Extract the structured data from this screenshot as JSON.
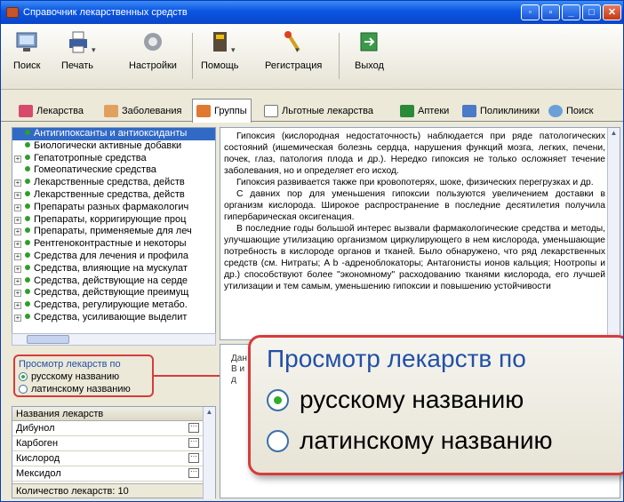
{
  "window": {
    "title": "Справочник лекарственных средств"
  },
  "toolbar": {
    "search": "Поиск",
    "print": "Печать",
    "settings": "Настройки",
    "help": "Помощь",
    "registration": "Регистрация",
    "exit": "Выход"
  },
  "tabs": [
    "Лекарства",
    "Заболевания",
    "Группы",
    "Льготные лекарства",
    "Аптеки",
    "Поликлиники",
    "Поиск"
  ],
  "tree": [
    "Антигипоксанты и антиоксиданты",
    "Биологически активные добавки",
    "Гепатотропные средства",
    "Гомеопатические средства",
    "Лекарственные средства, действ",
    "Лекарственные средства, действ",
    "Препараты разных фармакологич",
    "Препараты, корригирующие проц",
    "Препараты, применяемые для леч",
    "Рентгеноконтрастные и некоторы",
    "Средства для лечения и профила",
    "Средства, влияющие на мускулат",
    "Средства, действующие на серде",
    "Средства, действующие преимущ",
    "Средства, регулирующие метабо.",
    "Средства, усиливающие выделит"
  ],
  "article": [
    "Гипоксия (кислородная недостаточность) наблюдается при ряде патологических состояний (ишемическая болезнь сердца, нарушения функций мозга, легких, печени, почек, глаз, патология плода и др.). Нередко гипоксия не только осложняет течение заболевания, но и определяет его исход.",
    "Гипоксия развивается также при кровопотерях, шоке, физических перегрузках и др.",
    "С давних пор для уменьшения гипоксии пользуются увеличением доставки в организм кислорода. Широкое распространение в последние десятилетия получила гипербарическая оксигенация.",
    "В последние годы большой интерес вызвали фармакологические средства и методы, улучшающие утилизацию организмом циркулирующего в нем кислорода, уменьшающие потребность в кислороде органов и тканей. Было обнаружено, что ряд лекарственных средств (см. Нитраты; A b -адреноблокаторы; Антагонисты ионов кальция; Ноотропы и др.) способствуют более \"экономному\" расходованию тканями кислорода, его лучшей утилизации и тем самым, уменьшению гипоксии и повышению устойчивости"
  ],
  "view_by": {
    "title": "Просмотр лекарств по",
    "russian": "русскому названию",
    "latin": "латинскому названию"
  },
  "zoom": {
    "title": "Просмотр лекарств по",
    "russian": "русскому названию",
    "latin": "латинскому названию"
  },
  "drugs": {
    "header": "Названия лекарств",
    "items": [
      "Дибунол",
      "Карбоген",
      "Кислород",
      "Мексидол"
    ],
    "count": "Количество лекарств: 10"
  },
  "bottom_fragment": [
    "Дан",
    "В и",
    "д"
  ],
  "colors": {
    "title_bar": "#0a55e3",
    "highlight": "#d63c3c",
    "selection": "#316ac5",
    "link_blue": "#2250a8"
  }
}
